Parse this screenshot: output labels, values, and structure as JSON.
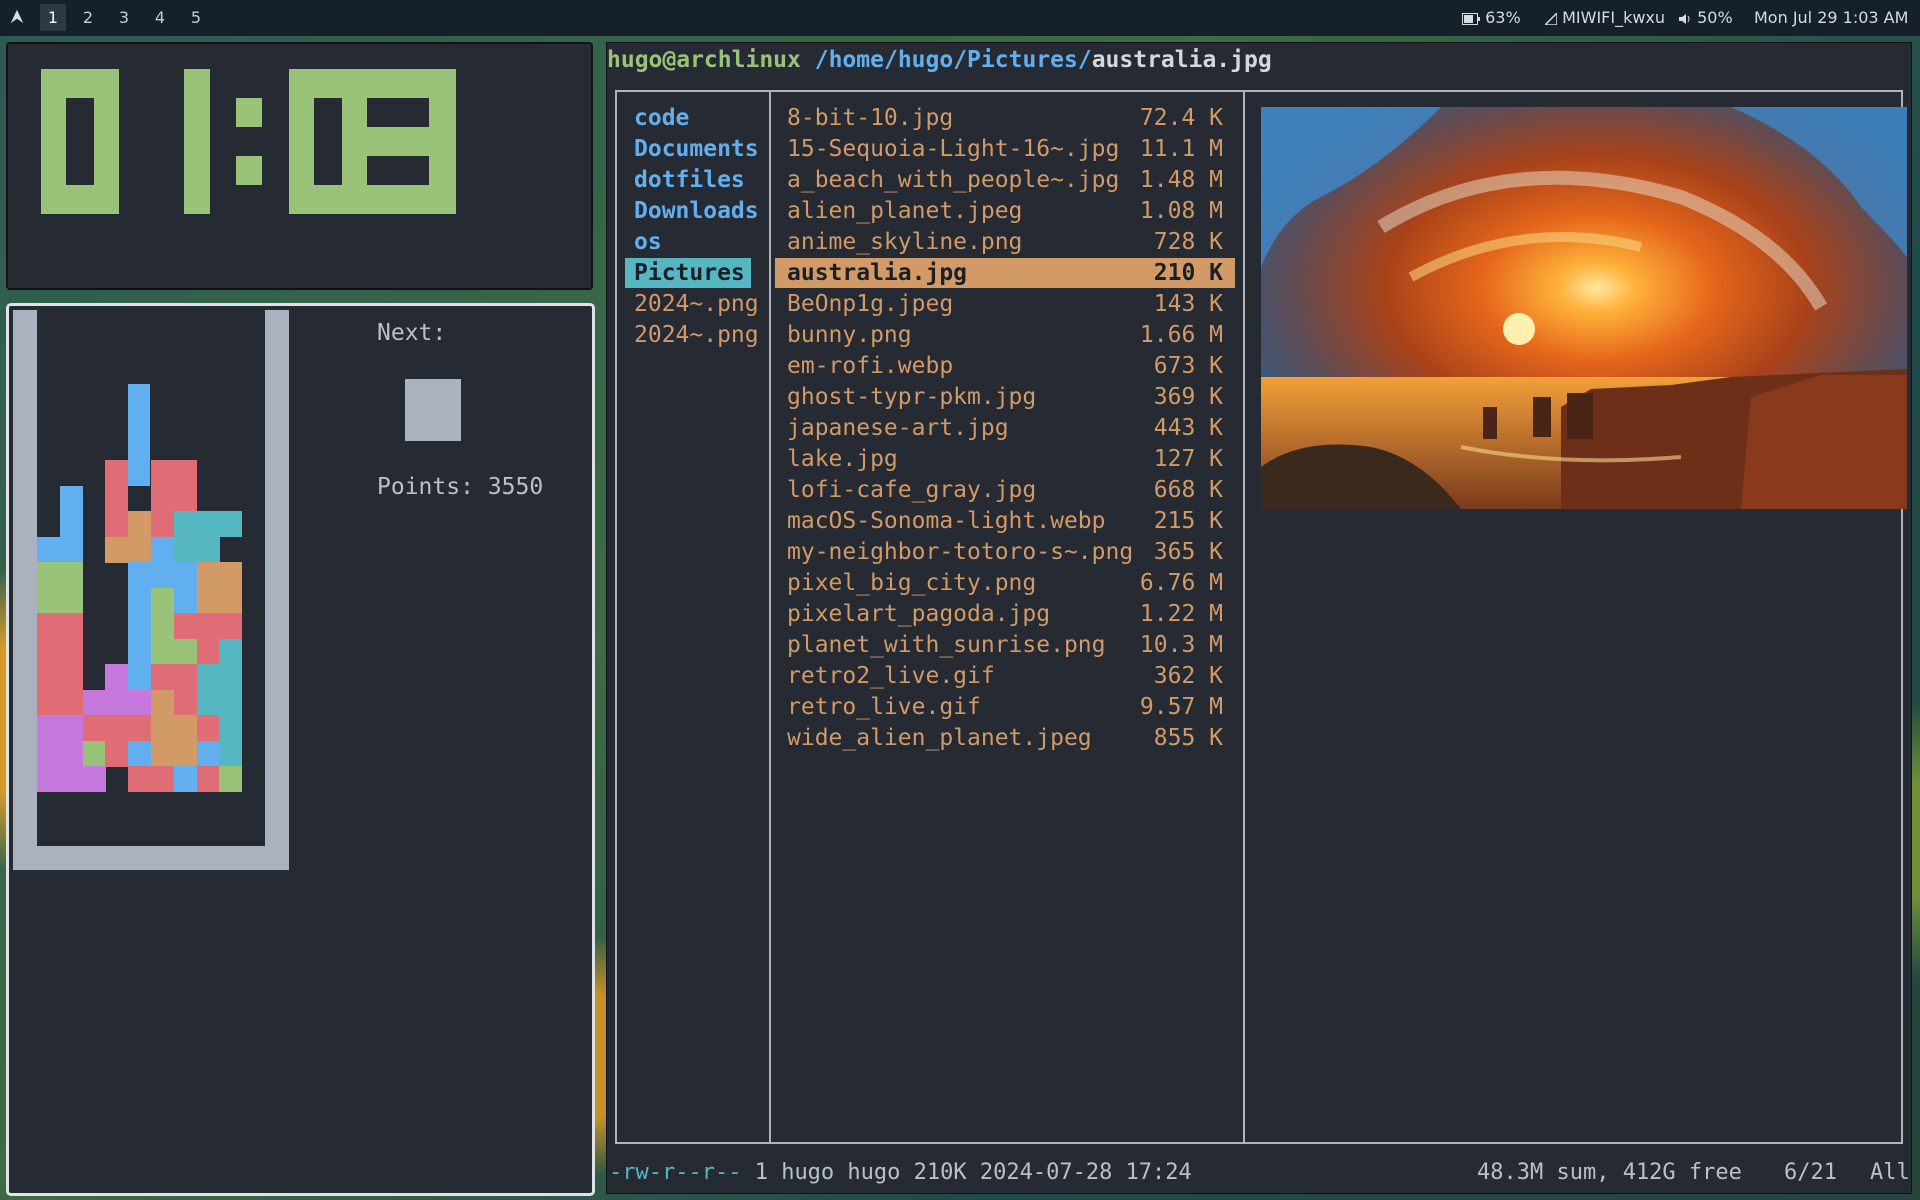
{
  "topbar": {
    "workspaces": [
      "1",
      "2",
      "3",
      "4",
      "5"
    ],
    "active_workspace": "1",
    "battery": "63%",
    "wifi": "MIWIFI_kwxu",
    "volume": "50%",
    "datetime": "Mon Jul 29  1:03 AM"
  },
  "clock": {
    "time": "01:03",
    "color": "#98c379"
  },
  "tetris": {
    "next_label": "Next:",
    "points_label": "Points: 3550",
    "colors": {
      "red": "#e06c75",
      "blue": "#61afef",
      "green": "#98c379",
      "orange": "#d19a66",
      "purple": "#c678dd",
      "cyan": "#56b6c2",
      "gray": "#abb2bf"
    },
    "falling_piece": "I",
    "next_piece": "O"
  },
  "ranger": {
    "user_host": "hugo@archlinux",
    "path": "/home/hugo/Pictures/",
    "current_file": "australia.jpg",
    "parent_dirs": [
      {
        "name": "code",
        "kind": "dir"
      },
      {
        "name": "Documents",
        "kind": "dir"
      },
      {
        "name": "dotfiles",
        "kind": "dir"
      },
      {
        "name": "Downloads",
        "kind": "dir"
      },
      {
        "name": "os",
        "kind": "dir"
      },
      {
        "name": "Pictures",
        "kind": "dir-selected"
      },
      {
        "name": "2024~.png",
        "kind": "image"
      },
      {
        "name": "2024~.png",
        "kind": "image"
      }
    ],
    "files": [
      {
        "name": "8-bit-10.jpg",
        "size": "72.4 K"
      },
      {
        "name": "15-Sequoia-Light-16~.jpg",
        "size": "11.1 M"
      },
      {
        "name": "a_beach_with_people~.jpg",
        "size": "1.48 M"
      },
      {
        "name": "alien_planet.jpeg",
        "size": "1.08 M"
      },
      {
        "name": "anime_skyline.png",
        "size": "728 K"
      },
      {
        "name": "australia.jpg",
        "size": "210 K"
      },
      {
        "name": "BeOnp1g.jpeg",
        "size": "143 K"
      },
      {
        "name": "bunny.png",
        "size": "1.66 M"
      },
      {
        "name": "em-rofi.webp",
        "size": "673 K"
      },
      {
        "name": "ghost-typr-pkm.jpg",
        "size": "369 K"
      },
      {
        "name": "japanese-art.jpg",
        "size": "443 K"
      },
      {
        "name": "lake.jpg",
        "size": "127 K"
      },
      {
        "name": "lofi-cafe_gray.jpg",
        "size": "668 K"
      },
      {
        "name": "macOS-Sonoma-light.webp",
        "size": "215 K"
      },
      {
        "name": "my-neighbor-totoro-s~.png",
        "size": "365 K"
      },
      {
        "name": "pixel_big_city.png",
        "size": "6.76 M"
      },
      {
        "name": "pixelart_pagoda.jpg",
        "size": "1.22 M"
      },
      {
        "name": "planet_with_sunrise.png",
        "size": "10.3 M"
      },
      {
        "name": "retro2_live.gif",
        "size": "362 K"
      },
      {
        "name": "retro_live.gif",
        "size": "9.57 M"
      },
      {
        "name": "wide_alien_planet.jpeg",
        "size": "855 K"
      }
    ],
    "selected_file": "australia.jpg",
    "status": {
      "permissions": "-rw-r--r--",
      "info": "1 hugo hugo 210K 2024-07-28 17:24",
      "summary": "48.3M sum, 412G free",
      "position": "6/21",
      "scope": "All"
    }
  }
}
